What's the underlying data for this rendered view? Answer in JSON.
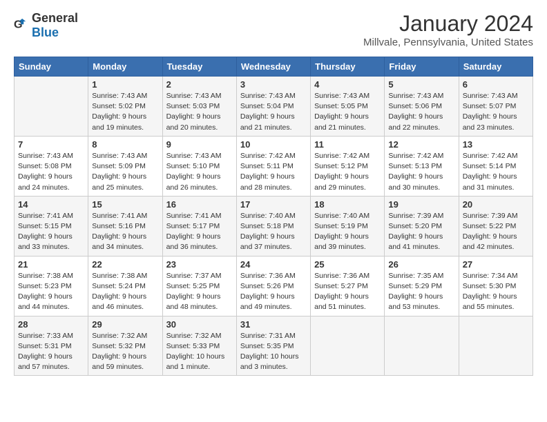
{
  "logo": {
    "general": "General",
    "blue": "Blue"
  },
  "title": "January 2024",
  "subtitle": "Millvale, Pennsylvania, United States",
  "days_header": [
    "Sunday",
    "Monday",
    "Tuesday",
    "Wednesday",
    "Thursday",
    "Friday",
    "Saturday"
  ],
  "weeks": [
    [
      {
        "day": "",
        "info": ""
      },
      {
        "day": "1",
        "info": "Sunrise: 7:43 AM\nSunset: 5:02 PM\nDaylight: 9 hours and 19 minutes."
      },
      {
        "day": "2",
        "info": "Sunrise: 7:43 AM\nSunset: 5:03 PM\nDaylight: 9 hours and 20 minutes."
      },
      {
        "day": "3",
        "info": "Sunrise: 7:43 AM\nSunset: 5:04 PM\nDaylight: 9 hours and 21 minutes."
      },
      {
        "day": "4",
        "info": "Sunrise: 7:43 AM\nSunset: 5:05 PM\nDaylight: 9 hours and 21 minutes."
      },
      {
        "day": "5",
        "info": "Sunrise: 7:43 AM\nSunset: 5:06 PM\nDaylight: 9 hours and 22 minutes."
      },
      {
        "day": "6",
        "info": "Sunrise: 7:43 AM\nSunset: 5:07 PM\nDaylight: 9 hours and 23 minutes."
      }
    ],
    [
      {
        "day": "7",
        "info": "Sunrise: 7:43 AM\nSunset: 5:08 PM\nDaylight: 9 hours and 24 minutes."
      },
      {
        "day": "8",
        "info": "Sunrise: 7:43 AM\nSunset: 5:09 PM\nDaylight: 9 hours and 25 minutes."
      },
      {
        "day": "9",
        "info": "Sunrise: 7:43 AM\nSunset: 5:10 PM\nDaylight: 9 hours and 26 minutes."
      },
      {
        "day": "10",
        "info": "Sunrise: 7:42 AM\nSunset: 5:11 PM\nDaylight: 9 hours and 28 minutes."
      },
      {
        "day": "11",
        "info": "Sunrise: 7:42 AM\nSunset: 5:12 PM\nDaylight: 9 hours and 29 minutes."
      },
      {
        "day": "12",
        "info": "Sunrise: 7:42 AM\nSunset: 5:13 PM\nDaylight: 9 hours and 30 minutes."
      },
      {
        "day": "13",
        "info": "Sunrise: 7:42 AM\nSunset: 5:14 PM\nDaylight: 9 hours and 31 minutes."
      }
    ],
    [
      {
        "day": "14",
        "info": "Sunrise: 7:41 AM\nSunset: 5:15 PM\nDaylight: 9 hours and 33 minutes."
      },
      {
        "day": "15",
        "info": "Sunrise: 7:41 AM\nSunset: 5:16 PM\nDaylight: 9 hours and 34 minutes."
      },
      {
        "day": "16",
        "info": "Sunrise: 7:41 AM\nSunset: 5:17 PM\nDaylight: 9 hours and 36 minutes."
      },
      {
        "day": "17",
        "info": "Sunrise: 7:40 AM\nSunset: 5:18 PM\nDaylight: 9 hours and 37 minutes."
      },
      {
        "day": "18",
        "info": "Sunrise: 7:40 AM\nSunset: 5:19 PM\nDaylight: 9 hours and 39 minutes."
      },
      {
        "day": "19",
        "info": "Sunrise: 7:39 AM\nSunset: 5:20 PM\nDaylight: 9 hours and 41 minutes."
      },
      {
        "day": "20",
        "info": "Sunrise: 7:39 AM\nSunset: 5:22 PM\nDaylight: 9 hours and 42 minutes."
      }
    ],
    [
      {
        "day": "21",
        "info": "Sunrise: 7:38 AM\nSunset: 5:23 PM\nDaylight: 9 hours and 44 minutes."
      },
      {
        "day": "22",
        "info": "Sunrise: 7:38 AM\nSunset: 5:24 PM\nDaylight: 9 hours and 46 minutes."
      },
      {
        "day": "23",
        "info": "Sunrise: 7:37 AM\nSunset: 5:25 PM\nDaylight: 9 hours and 48 minutes."
      },
      {
        "day": "24",
        "info": "Sunrise: 7:36 AM\nSunset: 5:26 PM\nDaylight: 9 hours and 49 minutes."
      },
      {
        "day": "25",
        "info": "Sunrise: 7:36 AM\nSunset: 5:27 PM\nDaylight: 9 hours and 51 minutes."
      },
      {
        "day": "26",
        "info": "Sunrise: 7:35 AM\nSunset: 5:29 PM\nDaylight: 9 hours and 53 minutes."
      },
      {
        "day": "27",
        "info": "Sunrise: 7:34 AM\nSunset: 5:30 PM\nDaylight: 9 hours and 55 minutes."
      }
    ],
    [
      {
        "day": "28",
        "info": "Sunrise: 7:33 AM\nSunset: 5:31 PM\nDaylight: 9 hours and 57 minutes."
      },
      {
        "day": "29",
        "info": "Sunrise: 7:32 AM\nSunset: 5:32 PM\nDaylight: 9 hours and 59 minutes."
      },
      {
        "day": "30",
        "info": "Sunrise: 7:32 AM\nSunset: 5:33 PM\nDaylight: 10 hours and 1 minute."
      },
      {
        "day": "31",
        "info": "Sunrise: 7:31 AM\nSunset: 5:35 PM\nDaylight: 10 hours and 3 minutes."
      },
      {
        "day": "",
        "info": ""
      },
      {
        "day": "",
        "info": ""
      },
      {
        "day": "",
        "info": ""
      }
    ]
  ]
}
